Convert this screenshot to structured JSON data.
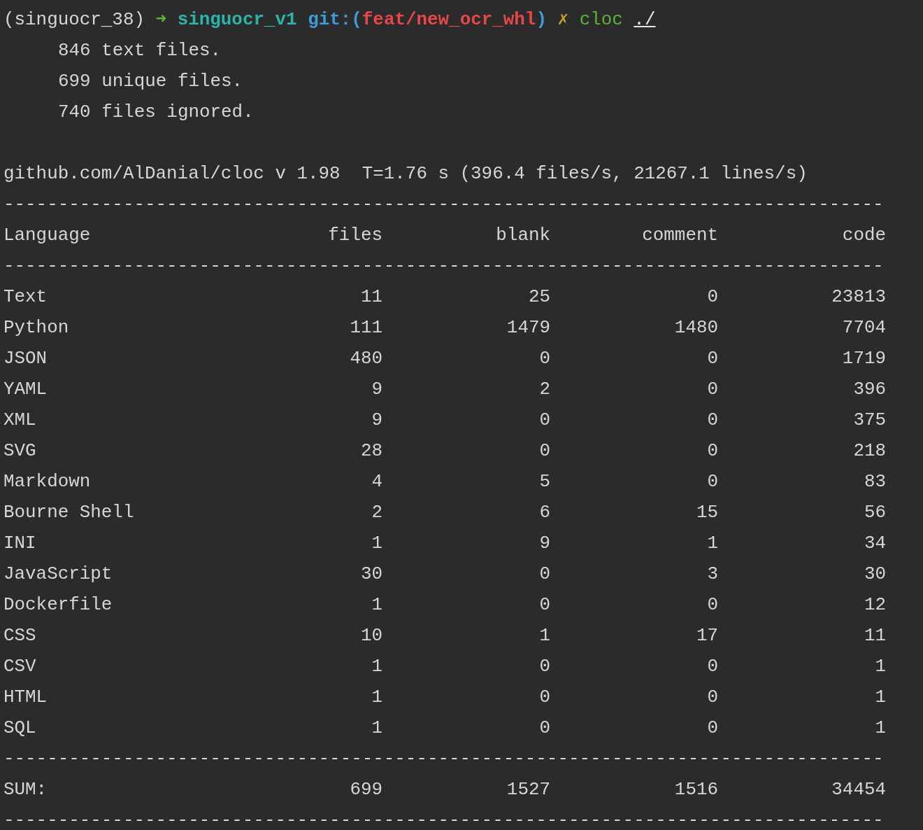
{
  "prompt": {
    "env": "(singuocr_38)",
    "arrow": "➜",
    "directory": "singuocr_v1",
    "git_prefix": "git:(",
    "branch": "feat/new_ocr_whl",
    "git_suffix": ")",
    "dirty_mark": "✗",
    "command": "cloc",
    "argument": "./"
  },
  "summary_lines": [
    "846 text files.",
    "699 unique files.",
    "740 files ignored."
  ],
  "info_line": "github.com/AlDanial/cloc v 1.98  T=1.76 s (396.4 files/s, 21267.1 lines/s)",
  "separator": "---------------------------------------------------------------------------------",
  "table": {
    "columns": [
      "Language",
      "files",
      "blank",
      "comment",
      "code"
    ],
    "rows": [
      [
        "Text",
        "11",
        "25",
        "0",
        "23813"
      ],
      [
        "Python",
        "111",
        "1479",
        "1480",
        "7704"
      ],
      [
        "JSON",
        "480",
        "0",
        "0",
        "1719"
      ],
      [
        "YAML",
        "9",
        "2",
        "0",
        "396"
      ],
      [
        "XML",
        "9",
        "0",
        "0",
        "375"
      ],
      [
        "SVG",
        "28",
        "0",
        "0",
        "218"
      ],
      [
        "Markdown",
        "4",
        "5",
        "0",
        "83"
      ],
      [
        "Bourne Shell",
        "2",
        "6",
        "15",
        "56"
      ],
      [
        "INI",
        "1",
        "9",
        "1",
        "34"
      ],
      [
        "JavaScript",
        "30",
        "0",
        "3",
        "30"
      ],
      [
        "Dockerfile",
        "1",
        "0",
        "0",
        "12"
      ],
      [
        "CSS",
        "10",
        "1",
        "17",
        "11"
      ],
      [
        "CSV",
        "1",
        "0",
        "0",
        "1"
      ],
      [
        "HTML",
        "1",
        "0",
        "0",
        "1"
      ],
      [
        "SQL",
        "1",
        "0",
        "0",
        "1"
      ]
    ],
    "sum": [
      "SUM:",
      "699",
      "1527",
      "1516",
      "34454"
    ]
  }
}
